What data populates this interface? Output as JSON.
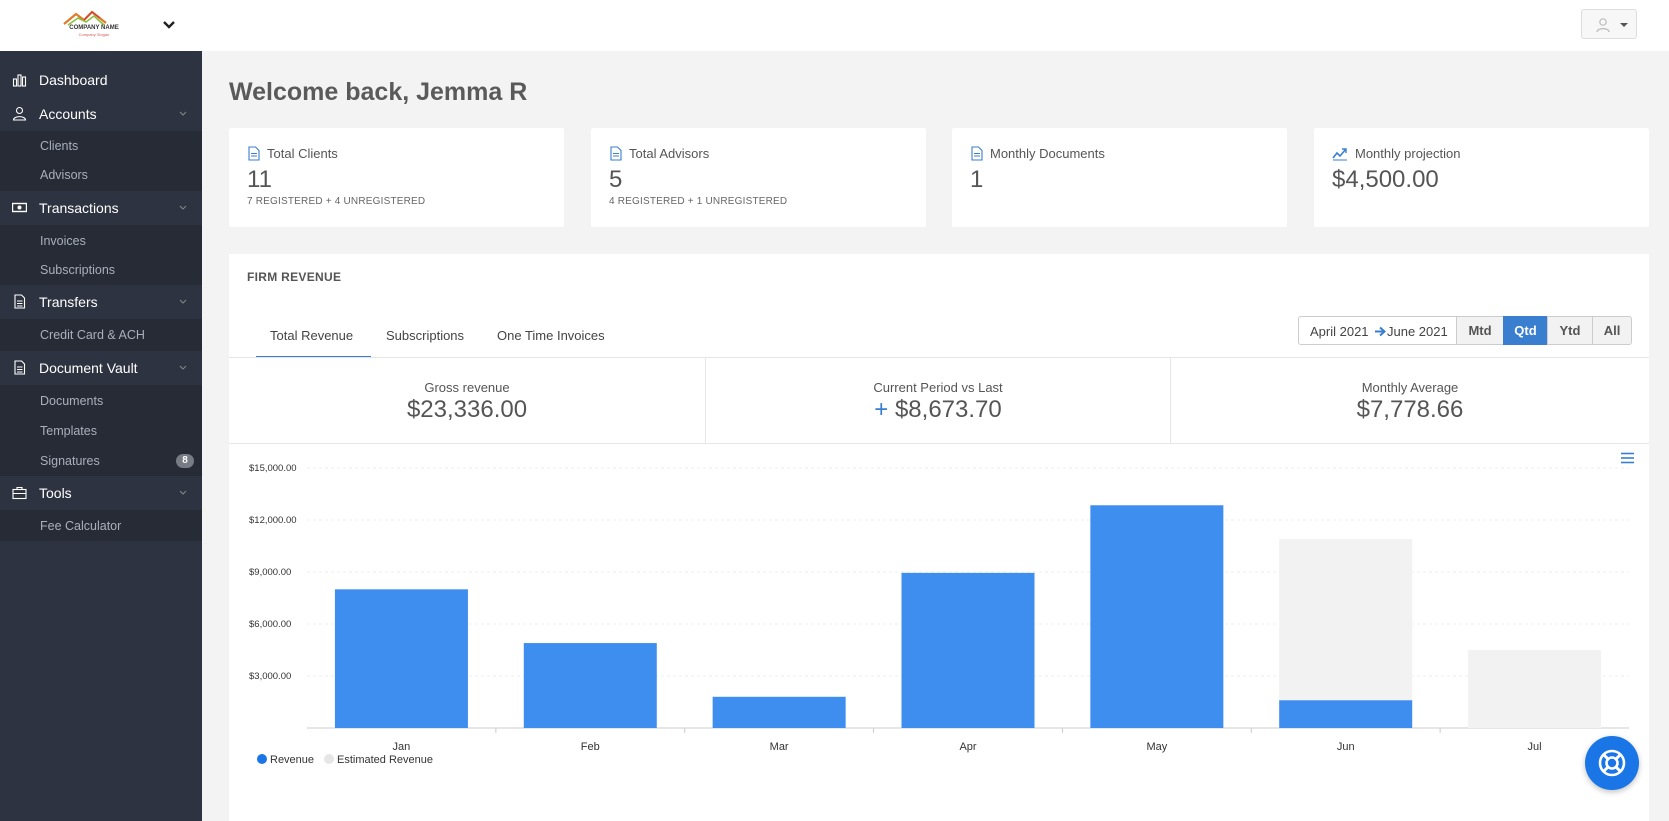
{
  "brand": {
    "name": "COMPANY NAME",
    "slogan": "Company Slogan"
  },
  "sidebar": {
    "items": [
      {
        "label": "Dashboard",
        "icon": "bar-chart-icon"
      },
      {
        "label": "Accounts",
        "icon": "user-icon",
        "children": [
          "Clients",
          "Advisors"
        ]
      },
      {
        "label": "Transactions",
        "icon": "money-icon",
        "children": [
          "Invoices",
          "Subscriptions"
        ]
      },
      {
        "label": "Transfers",
        "icon": "document-icon",
        "children": [
          "Credit Card & ACH"
        ]
      },
      {
        "label": "Document Vault",
        "icon": "document-icon",
        "children": [
          "Documents",
          "Templates",
          "Signatures"
        ],
        "badge": "8"
      },
      {
        "label": "Tools",
        "icon": "toolbox-icon",
        "children": [
          "Fee Calculator"
        ]
      }
    ]
  },
  "welcome": "Welcome back, Jemma R",
  "stats": [
    {
      "title": "Total Clients",
      "value": "11",
      "sub": "7 REGISTERED + 4 UNREGISTERED"
    },
    {
      "title": "Total Advisors",
      "value": "5",
      "sub": "4 REGISTERED + 1 UNREGISTERED"
    },
    {
      "title": "Monthly Documents",
      "value": "1",
      "sub": ""
    },
    {
      "title": "Monthly projection",
      "value": "$4,500.00",
      "sub": ""
    }
  ],
  "revenue": {
    "title": "FIRM REVENUE",
    "tabs": [
      "Total Revenue",
      "Subscriptions",
      "One Time Invoices"
    ],
    "range_from": "April 2021",
    "range_to": "June 2021",
    "periods": [
      "Mtd",
      "Qtd",
      "Ytd",
      "All"
    ],
    "active_period": "Qtd",
    "kpis": [
      {
        "label": "Gross revenue",
        "value": "$23,336.00",
        "prefix": ""
      },
      {
        "label": "Current Period vs Last",
        "value": "$8,673.70",
        "prefix": "+"
      },
      {
        "label": "Monthly Average",
        "value": "$7,778.66",
        "prefix": ""
      }
    ]
  },
  "colors": {
    "sidebar_bg": "#2d3340",
    "accent": "#3a7ed0",
    "revenue_bar": "#3e8ef0",
    "estimated_bar": "#f2f2f2"
  },
  "chart_data": {
    "type": "bar",
    "categories": [
      "Jan",
      "Feb",
      "Mar",
      "Apr",
      "May",
      "Jun",
      "Jul"
    ],
    "series": [
      {
        "name": "Revenue",
        "values": [
          8000,
          4900,
          1800,
          8950,
          12850,
          1600,
          0
        ]
      },
      {
        "name": "Estimated Revenue",
        "values": [
          0,
          0,
          0,
          0,
          0,
          10900,
          4500
        ]
      }
    ],
    "yticks": [
      "$3,000.00",
      "$6,000.00",
      "$9,000.00",
      "$12,000.00",
      "$15,000.00"
    ],
    "ylim": [
      0,
      15000
    ],
    "stacked": false,
    "grid": true,
    "legend": "bottom-left"
  }
}
